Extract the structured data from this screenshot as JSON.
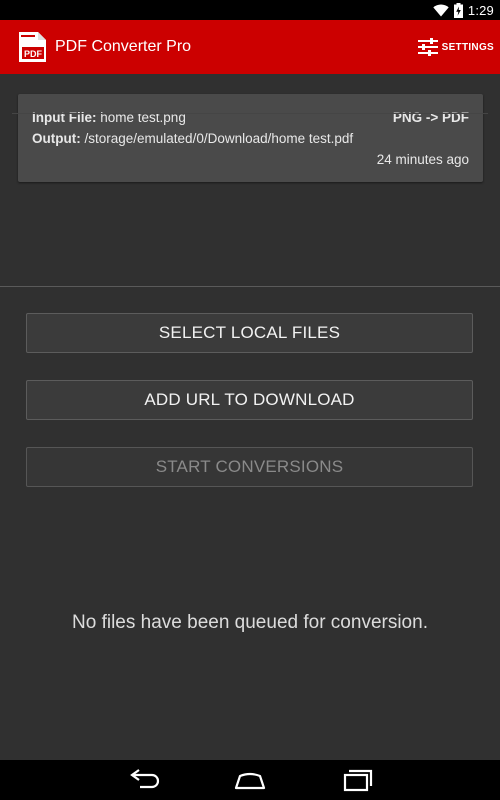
{
  "status_bar": {
    "time": "1:29"
  },
  "app_bar": {
    "title": "PDF Converter Pro",
    "logo_text": "PDF",
    "settings_label": "SETTINGS"
  },
  "queue_card": {
    "input_label": "Input File:",
    "input_value": "home test.png",
    "output_label": "Output:",
    "output_value": "/storage/emulated/0/Download/home test.pdf",
    "conversion_type": "PNG -> PDF",
    "timestamp": "24 minutes ago"
  },
  "buttons": {
    "select_local_files": "SELECT LOCAL FILES",
    "add_url": "ADD URL TO DOWNLOAD",
    "start_conversions": "START CONVERSIONS"
  },
  "empty_message": "No files have been queued for conversion.",
  "colors": {
    "app_bar": "#cc0000",
    "background": "#303030",
    "card": "#4a4a4a"
  },
  "icons": {
    "status": [
      "wifi-icon",
      "battery-charging-icon"
    ],
    "app_bar": [
      "pdf-logo-icon",
      "sliders-icon"
    ],
    "nav": [
      "back-icon",
      "home-icon",
      "recents-icon"
    ]
  }
}
